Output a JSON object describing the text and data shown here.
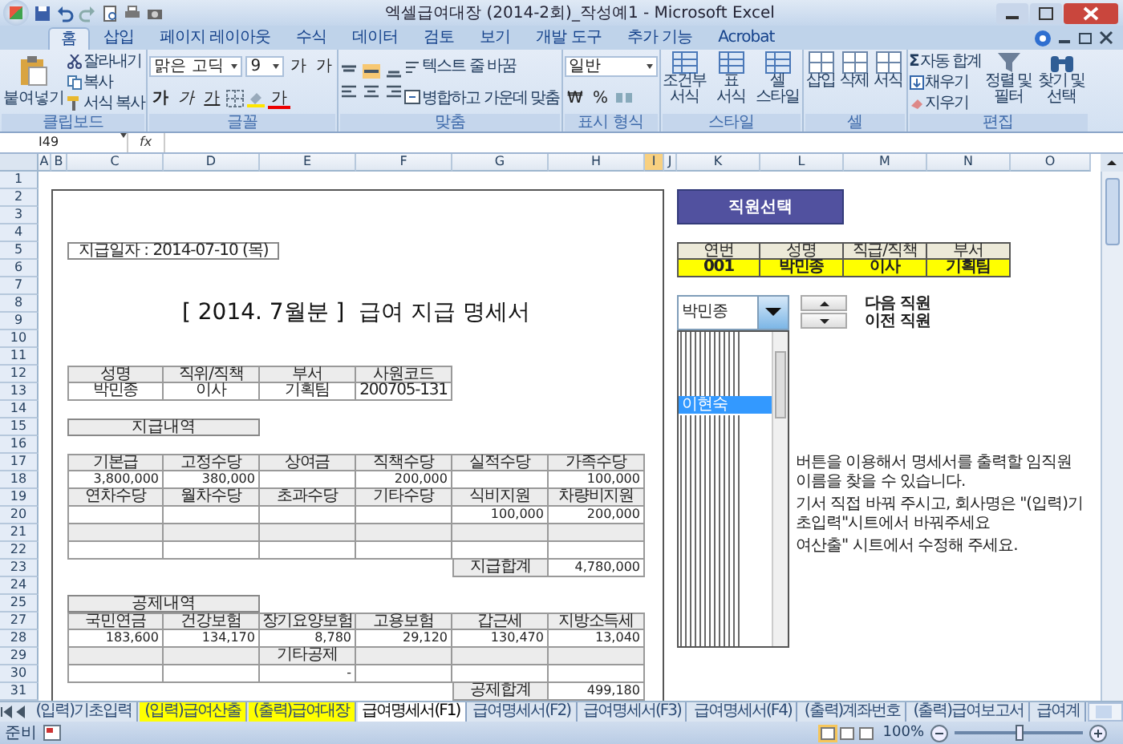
{
  "window": {
    "title": "엑셀급여대장 (2014-2회)_작성예1 - Microsoft Excel"
  },
  "ribbon_tabs": [
    {
      "label": "홈",
      "selected": true
    },
    {
      "label": "삽입",
      "selected": false
    },
    {
      "label": "페이지 레이아웃",
      "selected": false
    },
    {
      "label": "수식",
      "selected": false
    },
    {
      "label": "데이터",
      "selected": false
    },
    {
      "label": "검토",
      "selected": false
    },
    {
      "label": "보기",
      "selected": false
    },
    {
      "label": "개발 도구",
      "selected": false
    },
    {
      "label": "추가 기능",
      "selected": false
    },
    {
      "label": "Acrobat",
      "selected": false
    }
  ],
  "ribbon": {
    "clipboard": {
      "label": "클립보드",
      "paste": "붙여넣기",
      "cut": "잘라내기",
      "copy": "복사",
      "format_painter": "서식 복사"
    },
    "font": {
      "label": "글꼴",
      "font_name": "맑은 고딕",
      "font_size": "9",
      "grow": "가",
      "shrink": "가",
      "bold": "가",
      "italic": "가",
      "underline": "가",
      "font_color": "가"
    },
    "alignment": {
      "label": "맞춤",
      "wrap_text": "텍스트 줄 바꿈",
      "merge_center": "병합하고 가운데 맞춤"
    },
    "number": {
      "label": "표시 형식",
      "format": "일반",
      "currency": "₩",
      "percent": "%"
    },
    "styles": {
      "label": "스타일",
      "items": [
        "조건부 서식",
        "표 서식",
        "셀 스타일"
      ]
    },
    "cells": {
      "label": "셀",
      "items": [
        "삽입",
        "삭제",
        "서식"
      ]
    },
    "editing": {
      "label": "편집",
      "autosum_symbol": "Σ",
      "autosum": "자동 합계",
      "fill": "채우기",
      "clear": "지우기",
      "sort_filter": "정렬 및 필터",
      "find_select": "찾기 및 선택"
    }
  },
  "formula_bar": {
    "name_box": "I49",
    "function_label": "fx"
  },
  "sheet": {
    "column_headers": [
      {
        "label": "A",
        "selected": false
      },
      {
        "label": "B",
        "selected": false
      },
      {
        "label": "C",
        "selected": false
      },
      {
        "label": "D",
        "selected": false
      },
      {
        "label": "E",
        "selected": false
      },
      {
        "label": "F",
        "selected": false
      },
      {
        "label": "G",
        "selected": false
      },
      {
        "label": "H",
        "selected": false
      },
      {
        "label": "I",
        "selected": true
      },
      {
        "label": "J",
        "selected": false
      },
      {
        "label": "K",
        "selected": false
      },
      {
        "label": "L",
        "selected": false
      },
      {
        "label": "M",
        "selected": false
      },
      {
        "label": "N",
        "selected": false
      },
      {
        "label": "O",
        "selected": false
      }
    ],
    "row_headers": [
      "1",
      "2",
      "3",
      "4",
      "5",
      "6",
      "7",
      "8",
      "9",
      "10",
      "11",
      "12",
      "13",
      "14",
      "15",
      "16",
      "17",
      "18",
      "19",
      "20",
      "21",
      "22",
      "23",
      "24",
      "25",
      "27",
      "28",
      "29",
      "30",
      "31"
    ]
  },
  "payslip": {
    "pay_date": "지급일자 : 2014-07-10 (목)",
    "title": "[ 2014. 7월분 ]  급여 지급 명세서",
    "employee_info": {
      "rows": [
        {
          "kind": "header",
          "cells": [
            "성명",
            "직위/직책",
            "부서",
            "사원코드"
          ]
        },
        {
          "kind": "value",
          "cells": [
            "박민종",
            "이사",
            "기획팀",
            "200705-131"
          ]
        }
      ]
    },
    "pay_section": "지급내역",
    "pay_table": {
      "rows": [
        {
          "kind": "header",
          "cells": [
            "기본급",
            "고정수당",
            "상여금",
            "직책수당",
            "실적수당",
            "가족수당"
          ]
        },
        {
          "kind": "value",
          "cells": [
            "3,800,000",
            "380,000",
            null,
            "200,000",
            null,
            "100,000"
          ]
        },
        {
          "kind": "header",
          "cells": [
            "연차수당",
            "월차수당",
            "초과수당",
            "기타수당",
            "식비지원",
            "차량비지원"
          ]
        },
        {
          "kind": "value",
          "cells": [
            null,
            null,
            null,
            null,
            "100,000",
            "200,000"
          ]
        },
        {
          "kind": "header",
          "cells": [
            null,
            null,
            null,
            null,
            null,
            null
          ]
        },
        {
          "kind": "value",
          "cells": [
            null,
            null,
            null,
            null,
            null,
            null
          ]
        }
      ],
      "total": {
        "label": "지급합계",
        "value": "4,780,000"
      }
    },
    "deduction_section": "공제내역",
    "deduction_table": {
      "rows": [
        {
          "kind": "header",
          "cells": [
            "국민연금",
            "건강보험",
            "장기요양보험",
            "고용보험",
            "갑근세",
            "지방소득세"
          ]
        },
        {
          "kind": "value",
          "cells": [
            "183,600",
            "134,170",
            "8,780",
            "29,120",
            "130,470",
            "13,040"
          ]
        },
        {
          "kind": "header",
          "cells": [
            null,
            null,
            "기타공제",
            null,
            null,
            null
          ]
        },
        {
          "kind": "value",
          "cells": [
            null,
            null,
            "-",
            null,
            null,
            null
          ]
        }
      ],
      "total": {
        "label": "공제합계",
        "value": "499,180"
      }
    }
  },
  "employee_select": {
    "button": "직원선택",
    "table": {
      "rows": [
        {
          "kind": "header",
          "cells": [
            "연번",
            "성명",
            "직급/직책",
            "부서"
          ]
        },
        {
          "kind": "value",
          "cells": [
            "001",
            "박민종",
            "이사",
            "기획팀"
          ]
        }
      ]
    },
    "combo_value": "박민종",
    "next_label": "다음 직원",
    "prev_label": "이전 직원",
    "list_highlighted_item": "이현숙",
    "instructions": [
      "버튼을 이용해서 명세서를 출력할 임직원 이름을 찾을 수 있습니다.",
      "기서 직접 바꿔 주시고, 회사명은 \"(입력)기초입력\"시트에서 바꿔주세요",
      "여산출\" 시트에서 수정해 주세요."
    ]
  },
  "sheet_tabs": [
    {
      "label": "(입력)기초입력",
      "selected": false
    },
    {
      "label": "(입력)급여산출",
      "selected": false,
      "color": "#ffff00"
    },
    {
      "label": "(출력)급여대장",
      "selected": false,
      "color": "#ffff00"
    },
    {
      "label": "급여명세서(F1)",
      "selected": true
    },
    {
      "label": "급여명세서(F2)",
      "selected": false
    },
    {
      "label": "급여명세서(F3)",
      "selected": false
    },
    {
      "label": "급여명세서(F4)",
      "selected": false
    },
    {
      "label": "(출력)계좌번호",
      "selected": false
    },
    {
      "label": "(출력)급여보고서",
      "selected": false
    },
    {
      "label": "급여계",
      "selected": false
    }
  ],
  "status_bar": {
    "status": "준비",
    "zoom": "100%",
    "zoom_slider": {
      "level": 0.5
    }
  }
}
